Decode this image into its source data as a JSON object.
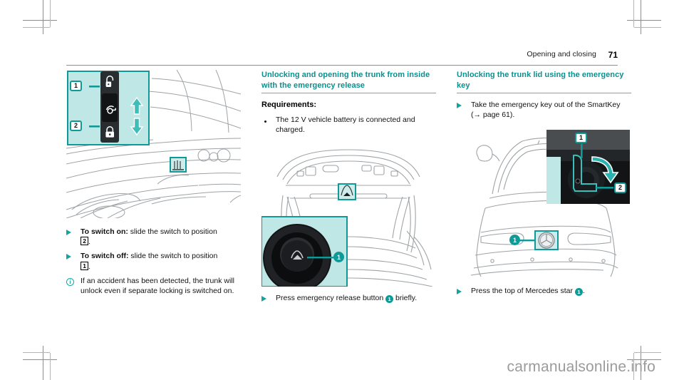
{
  "header": {
    "chapter": "Opening and closing",
    "page_number": "71"
  },
  "colors": {
    "teal": "#0f9a98",
    "teal_heading": "#0b8f8f",
    "teal_light": "#bfe7e6",
    "rule": "#8e8e8e"
  },
  "left_column": {
    "figure": {
      "name": "trunk-separate-locking-switch",
      "inset_labels": [
        "1",
        "2"
      ],
      "icons": [
        "unlock-icon",
        "trunk-separate-lock-icon",
        "lock-icon",
        "arrow-up-icon",
        "arrow-down-icon"
      ]
    },
    "items": [
      {
        "marker": "triangle",
        "bold": "To switch on:",
        "text": " slide the switch to position",
        "ref": "2",
        "tail": "."
      },
      {
        "marker": "triangle",
        "bold": "To switch off:",
        "text": " slide the switch to position",
        "ref": "1",
        "tail": "."
      },
      {
        "marker": "info",
        "bold": "",
        "text": "If an accident has been detected, the trunk will unlock even if separate locking is switched on.",
        "ref": "",
        "tail": ""
      }
    ]
  },
  "middle_column": {
    "heading": "Unlocking and opening the trunk from inside with the emergency release",
    "subheading": "Requirements:",
    "requirements": [
      "The 12 V vehicle battery is connected and charged."
    ],
    "figure": {
      "name": "trunk-lid-emergency-release",
      "inset_label": "1",
      "icons": [
        "emergency-release-button-icon"
      ]
    },
    "caption": {
      "marker": "triangle",
      "pre": "Press emergency release button",
      "ref": "1",
      "post": "briefly."
    }
  },
  "right_column": {
    "heading": "Unlocking the trunk lid using the emergency key",
    "items": [
      {
        "marker": "triangle",
        "text": "Take the emergency key out of the SmartKey (→ page 61)."
      }
    ],
    "figure": {
      "name": "trunk-lid-emergency-key-lock",
      "inset_labels": [
        "1",
        "2"
      ],
      "vehicle_labels": [
        "1"
      ],
      "icons": [
        "mercedes-star-icon",
        "rotate-arrow-icon"
      ]
    },
    "caption": {
      "marker": "triangle",
      "pre": "Press the top of Mercedes star",
      "ref": "1",
      "post": "."
    }
  },
  "watermark": "carmanualsonline.info"
}
